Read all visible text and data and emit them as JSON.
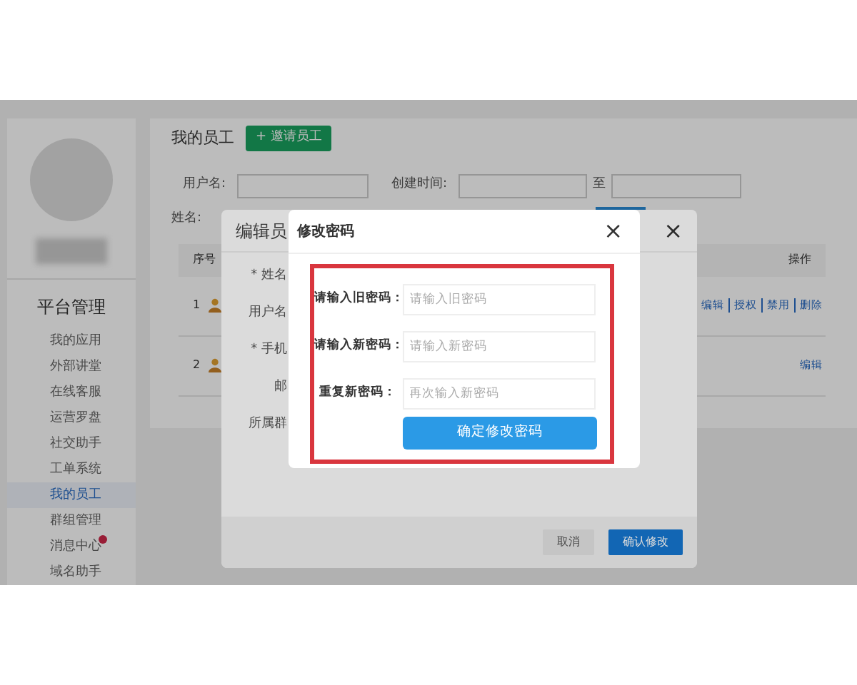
{
  "sidebar": {
    "title": "平台管理",
    "items": [
      {
        "label": "我的应用",
        "selected": false,
        "badge": false
      },
      {
        "label": "外部讲堂",
        "selected": false,
        "badge": false
      },
      {
        "label": "在线客服",
        "selected": false,
        "badge": false
      },
      {
        "label": "运营罗盘",
        "selected": false,
        "badge": false
      },
      {
        "label": "社交助手",
        "selected": false,
        "badge": false
      },
      {
        "label": "工单系统",
        "selected": false,
        "badge": false
      },
      {
        "label": "我的员工",
        "selected": true,
        "badge": false
      },
      {
        "label": "群组管理",
        "selected": false,
        "badge": false
      },
      {
        "label": "消息中心",
        "selected": false,
        "badge": true
      },
      {
        "label": "域名助手",
        "selected": false,
        "badge": false
      }
    ]
  },
  "main": {
    "title": "我的员工",
    "invite_button": "+ 邀请员工",
    "filters": {
      "username_label": "用户名:",
      "created_label": "创建时间:",
      "to_label": "至",
      "name_label": "姓名:"
    },
    "table": {
      "columns": [
        "序号",
        "操作"
      ],
      "rows": [
        {
          "index": "1",
          "actions": [
            "编辑",
            "授权",
            "禁用",
            "删除"
          ]
        },
        {
          "index": "2",
          "actions": [
            "编辑"
          ]
        }
      ]
    }
  },
  "edit_dialog": {
    "title": "编辑员",
    "fields": [
      {
        "label": "* 姓名"
      },
      {
        "label": "用户名"
      },
      {
        "label": "* 手机"
      },
      {
        "label": "邮"
      },
      {
        "label": "所属群"
      }
    ],
    "buttons": [
      {
        "label": "取消",
        "kind": "secondary"
      },
      {
        "label": "确认修改",
        "kind": "primary"
      }
    ]
  },
  "password_dialog": {
    "title": "修改密码",
    "close": "×",
    "fields": [
      {
        "label": "请输入旧密码：",
        "placeholder": "请输入旧密码"
      },
      {
        "label": "请输入新密码：",
        "placeholder": "请输入新密码"
      },
      {
        "label": "重复新密码：",
        "placeholder": "再次输入新密码"
      }
    ],
    "submit": "确定修改密码"
  },
  "edit_close": "×"
}
